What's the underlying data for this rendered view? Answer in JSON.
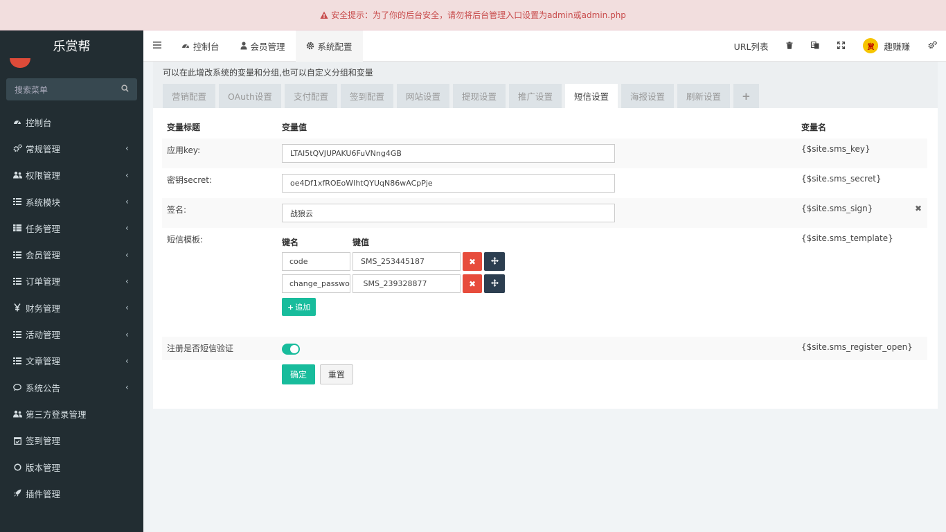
{
  "banner": {
    "text": "安全提示：为了你的后台安全，请勿将后台管理入口设置为admin或admin.php",
    "color": "#c84b4b"
  },
  "sidebar": {
    "logo": "乐赏帮",
    "search_placeholder": "搜索菜单",
    "items": [
      {
        "label": "控制台",
        "icon": "dashboard-icon",
        "has_children": false
      },
      {
        "label": "常规管理",
        "icon": "cogs-icon",
        "has_children": true
      },
      {
        "label": "权限管理",
        "icon": "users-icon",
        "has_children": true
      },
      {
        "label": "系统模块",
        "icon": "list-icon",
        "has_children": true
      },
      {
        "label": "任务管理",
        "icon": "table-icon",
        "has_children": true
      },
      {
        "label": "会员管理",
        "icon": "list-icon",
        "has_children": true
      },
      {
        "label": "订单管理",
        "icon": "list-icon",
        "has_children": true
      },
      {
        "label": "财务管理",
        "icon": "yen-icon",
        "has_children": true
      },
      {
        "label": "活动管理",
        "icon": "list-icon",
        "has_children": true
      },
      {
        "label": "文章管理",
        "icon": "list-icon",
        "has_children": true
      },
      {
        "label": "系统公告",
        "icon": "comment-icon",
        "has_children": true
      },
      {
        "label": "第三方登录管理",
        "icon": "users-icon",
        "has_children": false
      },
      {
        "label": "签到管理",
        "icon": "calendar-check-icon",
        "has_children": false
      },
      {
        "label": "版本管理",
        "icon": "circle-icon",
        "has_children": false
      },
      {
        "label": "插件管理",
        "icon": "rocket-icon",
        "has_children": false
      }
    ]
  },
  "navbar": {
    "tabs": [
      {
        "label": "控制台",
        "icon": "dashboard-icon",
        "active": false
      },
      {
        "label": "会员管理",
        "icon": "user-icon",
        "active": false
      },
      {
        "label": "系统配置",
        "icon": "gear-icon",
        "active": true
      }
    ],
    "url_list": "URL列表",
    "user_name": "趣赚赚",
    "user_avatar_text": "赏"
  },
  "content": {
    "hint": "可以在此增改系统的变量和分组,也可以自定义分组和变量",
    "tabs": [
      "营销配置",
      "OAuth设置",
      "支付配置",
      "签到配置",
      "网站设置",
      "提现设置",
      "推广设置",
      "短信设置",
      "海报设置",
      "刷新设置",
      "+"
    ],
    "active_tab": 7,
    "table_headers": {
      "title": "变量标题",
      "value": "变量值",
      "name": "变量名"
    },
    "rows": [
      {
        "title": "应用key:",
        "value": "LTAI5tQVJUPAKU6FuVNng4GB",
        "name": "{$site.sms_key}"
      },
      {
        "title": "密钥secret:",
        "value": "oe4Df1xfROEoWIhtQYUqN86wACpPje",
        "name": "{$site.sms_secret}"
      },
      {
        "title": "签名:",
        "value": "战狼云",
        "name": "{$site.sms_sign}"
      }
    ],
    "template_row": {
      "title": "短信模板:",
      "name": "{$site.sms_template}",
      "key_header": "键名",
      "value_header": "键值",
      "pairs": [
        {
          "key": "code",
          "value": "SMS_253445187"
        },
        {
          "key": "change_password",
          "value": " SMS_239328877"
        }
      ],
      "add_label": "追加"
    },
    "register_row": {
      "title": "注册是否短信验证",
      "name": "{$site.sms_register_open}",
      "enabled": true
    },
    "buttons": {
      "ok": "确定",
      "reset": "重置"
    }
  },
  "colors": {
    "sidebar_bg": "#222d32",
    "accent": "#18bc9c",
    "danger": "#e74c3c",
    "dark": "#2c3e50"
  }
}
